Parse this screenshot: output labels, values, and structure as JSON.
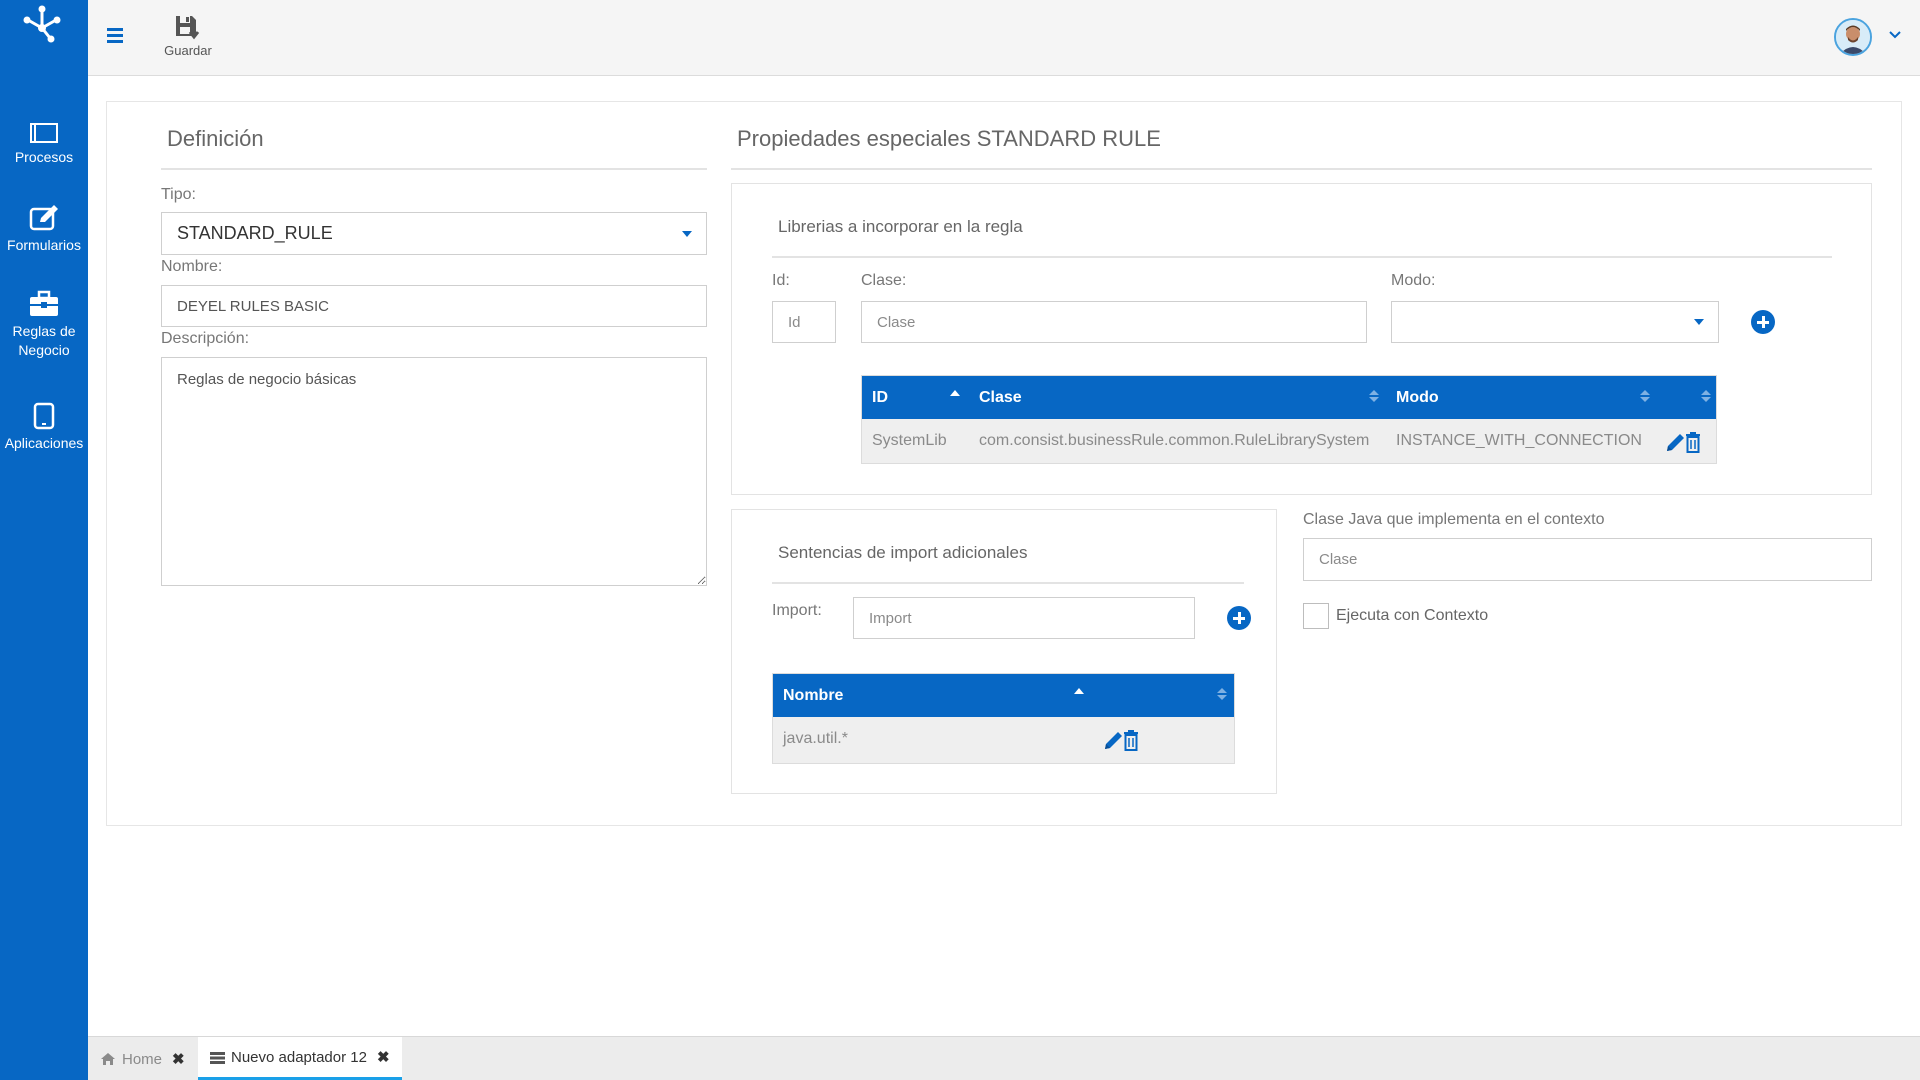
{
  "sidebar": {
    "logo": "deyel-logo-icon",
    "items": [
      {
        "label": "Procesos",
        "icon": "window-icon"
      },
      {
        "label": "Formularios",
        "icon": "edit-icon"
      },
      {
        "label": "Reglas de Negocio",
        "icon": "briefcase-icon"
      },
      {
        "label": "Aplicaciones",
        "icon": "tablet-icon"
      }
    ]
  },
  "topbar": {
    "menu_icon": "hamburger-icon",
    "save_label": "Guardar",
    "save_icon": "floppy-disk-icon"
  },
  "definition": {
    "title": "Definición",
    "type_label": "Tipo:",
    "type_value": "STANDARD_RULE",
    "name_label": "Nombre:",
    "name_value": "DEYEL RULES BASIC",
    "description_label": "Descripción:",
    "description_value": "Reglas de negocio básicas"
  },
  "special": {
    "title": "Propiedades especiales STANDARD RULE",
    "libraries": {
      "title": "Librerias a incorporar en la regla",
      "id_label": "Id:",
      "id_placeholder": "Id",
      "class_label": "Clase:",
      "class_placeholder": "Clase",
      "mode_label": "Modo:",
      "mode_value": "",
      "columns": [
        "ID",
        "Clase",
        "Modo"
      ],
      "rows": [
        {
          "id": "SystemLib",
          "clase": "com.consist.businessRule.common.RuleLibrarySystem",
          "modo": "INSTANCE_WITH_CONNECTION"
        }
      ]
    },
    "imports": {
      "title": "Sentencias de import adicionales",
      "import_label": "Import:",
      "import_placeholder": "Import",
      "columns": [
        "Nombre"
      ],
      "rows": [
        {
          "nombre": "java.util.*"
        }
      ]
    },
    "java_class_label": "Clase Java que implementa en el contexto",
    "java_class_placeholder": "Clase",
    "execute_context_label": "Ejecuta con Contexto",
    "execute_context_checked": false
  },
  "bottom_tabs": [
    {
      "label": "Home",
      "icon": "home-icon",
      "active": false
    },
    {
      "label": "Nuevo adaptador 12",
      "icon": "list-icon",
      "active": true
    }
  ],
  "colors": {
    "primary": "#0767c4",
    "topbar_bg": "#f5f5f5",
    "row_bg": "#efefef",
    "tab_active_underline": "#1aa0e8"
  }
}
